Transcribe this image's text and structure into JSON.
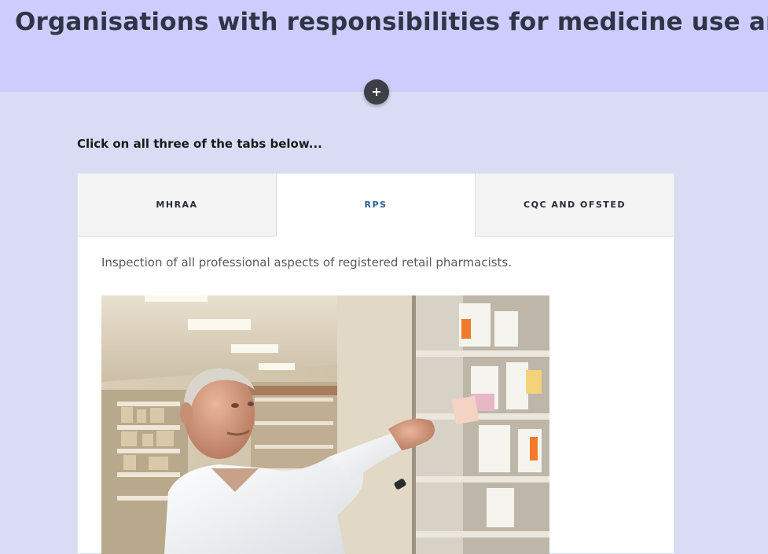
{
  "header": {
    "title": "Organisations with responsibilities for medicine use are:",
    "expand_symbol": "+",
    "background": "#cdccfc"
  },
  "content": {
    "instruction": "Click on all three of the tabs below..."
  },
  "tabs": [
    {
      "label": "MHRAA",
      "active": false
    },
    {
      "label": "RPS",
      "active": true
    },
    {
      "label": "CQC AND OFSTED",
      "active": false
    }
  ],
  "active_tab": {
    "text": "Inspection of all professional aspects of registered retail pharmacists.",
    "image": "pharmacist-photo"
  },
  "colors": {
    "page_background": "#dadcf5",
    "active_tab_text": "#2c5f9e",
    "title_text": "#2f3547"
  }
}
